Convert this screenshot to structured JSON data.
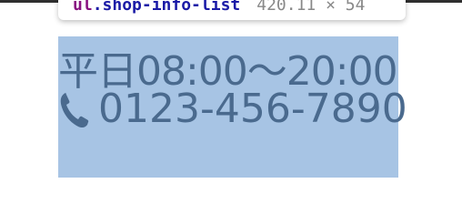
{
  "inspector": {
    "tag": "ul",
    "class_name": ".shop-info-list",
    "dimensions": "420.11 × 54"
  },
  "shop_info": {
    "hours": "平日08:00〜20:00",
    "phone": "0123-456-7890"
  },
  "icons": {
    "phone": "phone-icon"
  },
  "colors": {
    "highlight": "#a7c4e4",
    "text": "#4a6a8e",
    "tag": "#881280",
    "class": "#1a1aa6"
  }
}
